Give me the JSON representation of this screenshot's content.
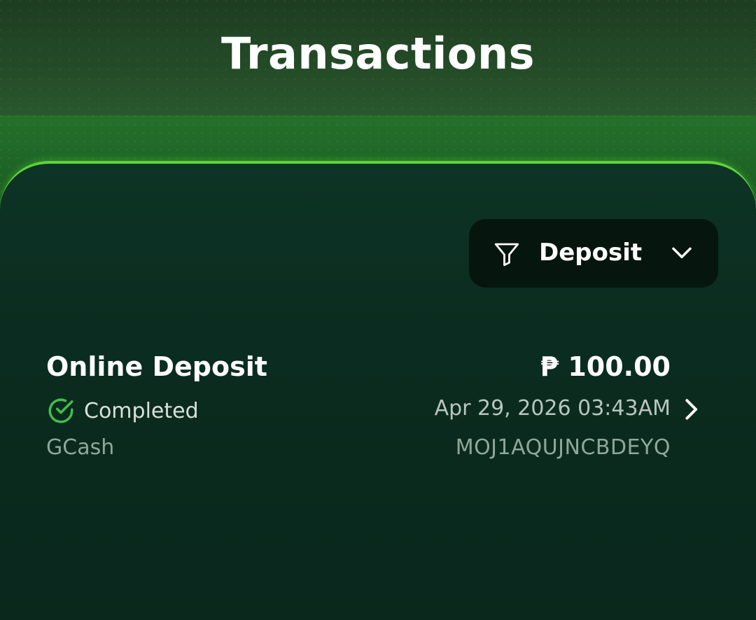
{
  "header": {
    "title": "Transactions"
  },
  "filter": {
    "label": "Deposit",
    "icon": "filter-icon",
    "chevron_icon": "chevron-down-icon"
  },
  "transactions": [
    {
      "type": "Online Deposit",
      "status": "Completed",
      "status_icon": "check-circle-icon",
      "method": "GCash",
      "amount": "₱ 100.00",
      "date": "Apr 29, 2026 03:43AM",
      "reference": "MOJ1AQUJNCBDEYQ"
    }
  ],
  "colors": {
    "accent": "#5fd33a",
    "success": "#3fbf4c",
    "panel": "#0b2c20",
    "header": "#234a27"
  }
}
